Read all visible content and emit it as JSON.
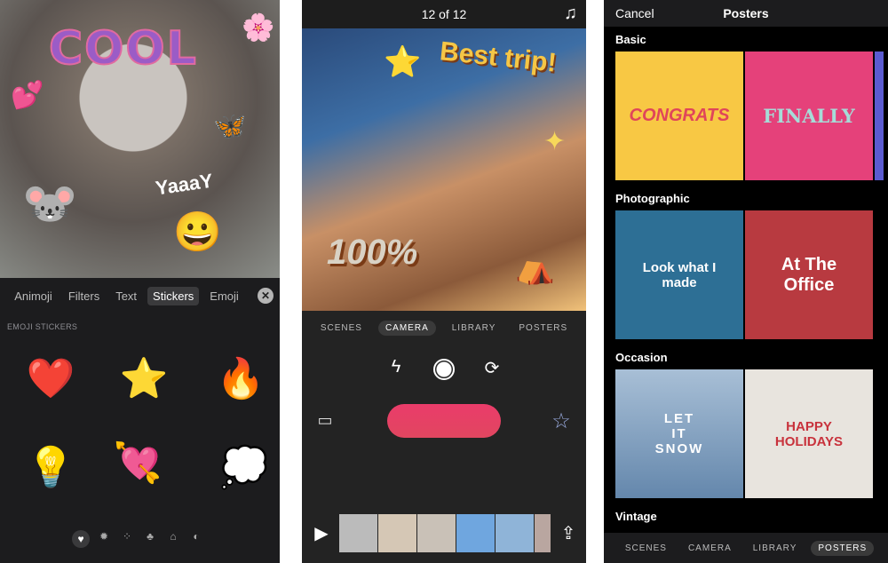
{
  "stickers_screen": {
    "photo_stickers": {
      "cool": "COOL",
      "yaaay": "YaaaY"
    },
    "tabs": [
      "Animoji",
      "Filters",
      "Text",
      "Stickers",
      "Emoji"
    ],
    "active_tab": "Stickers",
    "section_title": "EMOJI STICKERS",
    "emoji": [
      "❤️",
      "⭐",
      "🔥",
      "💡",
      "💘",
      "💭"
    ],
    "categories": [
      "heart-icon",
      "bug-icon",
      "shapes-icon",
      "mickey-icon",
      "building-icon",
      "planet-icon"
    ],
    "category_glyphs": [
      "♥",
      "✹",
      "⁘",
      "♣",
      "⌂",
      "◐"
    ]
  },
  "camera_screen": {
    "counter": "12 of 12",
    "photo_stickers": {
      "best_trip": "Best trip!",
      "hundred": "100%"
    },
    "tabs": [
      "SCENES",
      "CAMERA",
      "LIBRARY",
      "POSTERS"
    ],
    "active_tab": "CAMERA",
    "record_color": "#e8415f"
  },
  "posters_screen": {
    "cancel": "Cancel",
    "title": "Posters",
    "sections": [
      {
        "title": "Basic",
        "cards": [
          "CONGRATS",
          "FINALLY"
        ]
      },
      {
        "title": "Photographic",
        "cards": [
          "Look what I made",
          "At The Office"
        ]
      },
      {
        "title": "Occasion",
        "cards": [
          "LET IT SNOW",
          "HAPPY HOLIDAYS"
        ]
      },
      {
        "title": "Vintage",
        "cards": []
      }
    ],
    "tabs": [
      "SCENES",
      "CAMERA",
      "LIBRARY",
      "POSTERS"
    ],
    "active_tab": "POSTERS"
  }
}
